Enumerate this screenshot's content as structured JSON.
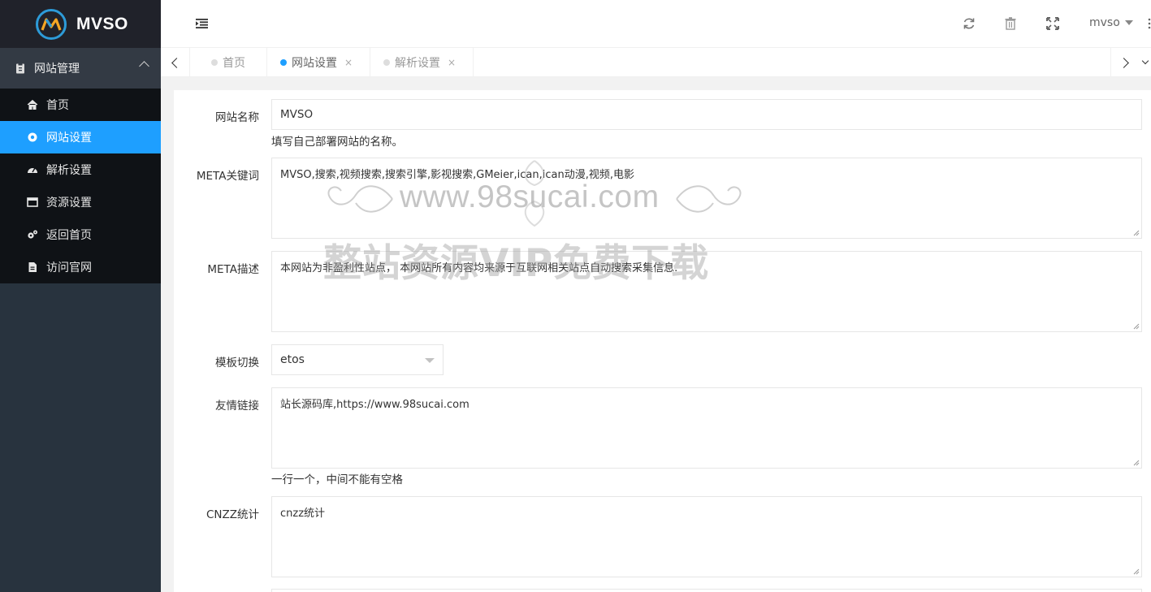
{
  "app": {
    "name": "MVSO"
  },
  "sidebar": {
    "group_label": "网站管理",
    "items": [
      {
        "label": "首页",
        "icon": "home-icon"
      },
      {
        "label": "网站设置",
        "icon": "settings-icon",
        "active": true
      },
      {
        "label": "解析设置",
        "icon": "dashboard-icon"
      },
      {
        "label": "资源设置",
        "icon": "window-icon"
      },
      {
        "label": "返回首页",
        "icon": "gears-icon"
      },
      {
        "label": "访问官网",
        "icon": "file-icon"
      }
    ]
  },
  "header": {
    "user": "mvso"
  },
  "tabs": [
    {
      "label": "首页",
      "closable": false
    },
    {
      "label": "网站设置",
      "closable": true,
      "active": true,
      "close": "×"
    },
    {
      "label": "解析设置",
      "closable": true,
      "close": "×"
    }
  ],
  "form": {
    "site_name": {
      "label": "网站名称",
      "value": "MVSO",
      "hint": "填写自己部署网站的名称。"
    },
    "meta_keywords": {
      "label": "META关键词",
      "value": "MVSO,搜索,视频搜索,搜索引擎,影视搜索,GMeier,ican,ican动漫,视频,电影"
    },
    "meta_desc": {
      "label": "META描述",
      "value": "本网站为非盈利性站点， 本网站所有内容均来源于互联网相关站点自动搜索采集信息."
    },
    "template": {
      "label": "模板切换",
      "value": "etos"
    },
    "links": {
      "label": "友情链接",
      "value": "站长源码库,https://www.98sucai.com",
      "hint": "一行一个，中间不能有空格"
    },
    "cnzz": {
      "label": "CNZZ统计",
      "value": "cnzz统计"
    }
  },
  "watermark": {
    "url": "www.98sucai.com",
    "text": "整站资源VIP免费下载"
  },
  "colors": {
    "accent": "#1e9fff",
    "sidebar_bg": "#28333e",
    "menu_bg": "#0f1216",
    "logo_bg": "#20222a"
  }
}
